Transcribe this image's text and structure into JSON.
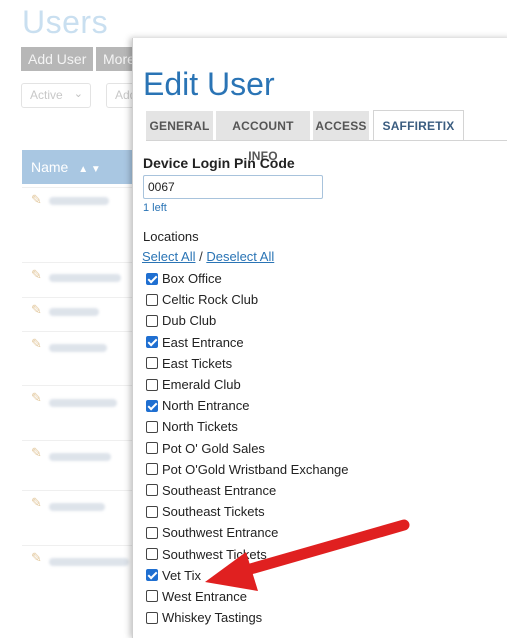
{
  "background": {
    "title": "Users",
    "buttons": [
      "Add User",
      "More"
    ],
    "status_select": "Active",
    "second_input": "Add",
    "table_header": "Name",
    "sort_icons": "▲ ▼"
  },
  "modal": {
    "title": "Edit User",
    "tabs": [
      {
        "label": "GENERAL",
        "active": false
      },
      {
        "label": "ACCOUNT INFO",
        "active": false
      },
      {
        "label": "ACCESS",
        "active": false
      },
      {
        "label": "SAFFIRETIX",
        "active": true
      }
    ],
    "pin": {
      "label": "Device Login Pin Code",
      "value": "0067",
      "remaining": "1 left"
    },
    "locations": {
      "label": "Locations",
      "select_all": "Select All",
      "separator": " / ",
      "deselect_all": "Deselect All",
      "items": [
        {
          "label": "Box Office",
          "checked": true
        },
        {
          "label": "Celtic Rock Club",
          "checked": false
        },
        {
          "label": "Dub Club",
          "checked": false
        },
        {
          "label": "East Entrance",
          "checked": true
        },
        {
          "label": "East Tickets",
          "checked": false
        },
        {
          "label": "Emerald Club",
          "checked": false
        },
        {
          "label": "North Entrance",
          "checked": true
        },
        {
          "label": "North Tickets",
          "checked": false
        },
        {
          "label": "Pot O' Gold Sales",
          "checked": false
        },
        {
          "label": "Pot O'Gold Wristband Exchange",
          "checked": false
        },
        {
          "label": "Southeast Entrance",
          "checked": false
        },
        {
          "label": "Southeast Tickets",
          "checked": false
        },
        {
          "label": "Southwest Entrance",
          "checked": false
        },
        {
          "label": "Southwest Tickets",
          "checked": false
        },
        {
          "label": "Vet Tix",
          "checked": true
        },
        {
          "label": "West Entrance",
          "checked": false
        },
        {
          "label": "Whiskey Tastings",
          "checked": false
        }
      ]
    }
  },
  "annotation": {
    "arrow_color": "#e02020",
    "points_to": "Vet Tix"
  },
  "colors": {
    "accent": "#2a74b5",
    "checkbox": "#1f6fd1",
    "header_bg": "#a9c7e2"
  }
}
